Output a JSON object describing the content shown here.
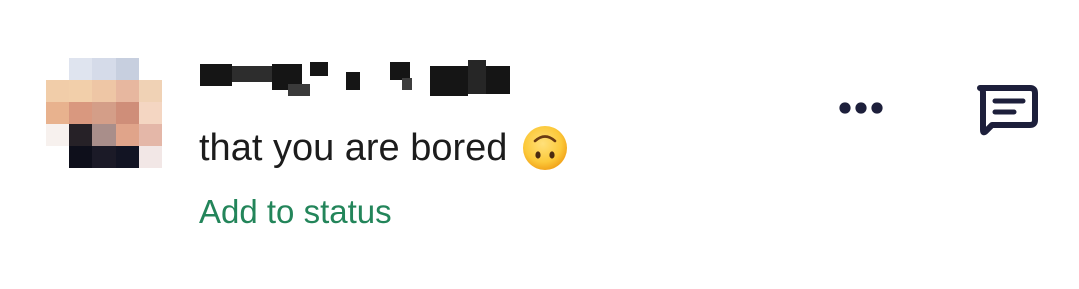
{
  "status_row": {
    "status_text": "that you are bored",
    "status_emoji": "upside-down-face",
    "add_to_status_label": "Add to status",
    "more_icon": "more-horizontal-icon",
    "message_icon": "message-icon",
    "accent_color": "#23855a",
    "icon_color": "#1d1f3b"
  }
}
